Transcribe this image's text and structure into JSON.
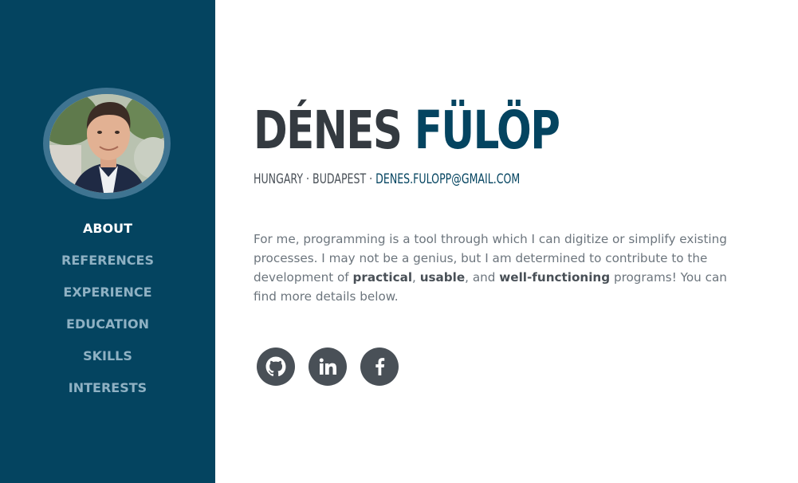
{
  "sidebar": {
    "avatar_alt": "Profile photo",
    "nav": [
      {
        "label": "ABOUT",
        "active": true
      },
      {
        "label": "REFERENCES",
        "active": false
      },
      {
        "label": "EXPERIENCE",
        "active": false
      },
      {
        "label": "EDUCATION",
        "active": false
      },
      {
        "label": "SKILLS",
        "active": false
      },
      {
        "label": "INTERESTS",
        "active": false
      }
    ]
  },
  "about": {
    "first_name": "DÉNES",
    "last_name": "FÜLÖP",
    "country": "HUNGARY",
    "city": "BUDAPEST",
    "separator": "·",
    "email": "DENES.FULOPP@GMAIL.COM",
    "lead": {
      "p1": "For me, programming is a tool through which I can digitize or simplify existing processes. I may not be a genius, but I am determined to contribute to the development of ",
      "b1": "practical",
      "p2": ", ",
      "b2": "usable",
      "p3": ", and ",
      "b3": "well-functioning",
      "p4": " programs! You can find more details below."
    }
  },
  "social": [
    {
      "icon": "github-icon"
    },
    {
      "icon": "linkedin-icon"
    },
    {
      "icon": "facebook-icon"
    }
  ],
  "colors": {
    "sidebar_bg": "#044460",
    "nav_inactive": "#8fb1c3",
    "nav_active": "#ffffff",
    "name_first": "#343a40",
    "name_last": "#044460",
    "social_bg": "#495057"
  }
}
